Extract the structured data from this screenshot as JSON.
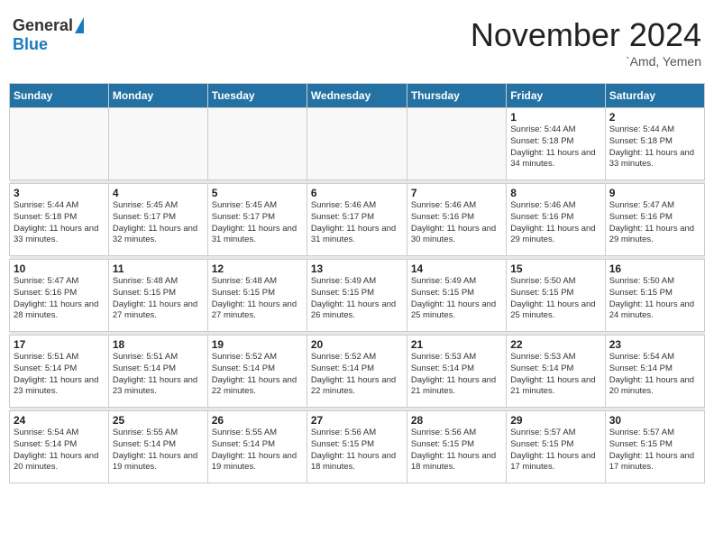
{
  "header": {
    "logo_general": "General",
    "logo_blue": "Blue",
    "month_title": "November 2024",
    "location": "`Amd, Yemen"
  },
  "weekdays": [
    "Sunday",
    "Monday",
    "Tuesday",
    "Wednesday",
    "Thursday",
    "Friday",
    "Saturday"
  ],
  "weeks": [
    [
      {
        "day": "",
        "info": ""
      },
      {
        "day": "",
        "info": ""
      },
      {
        "day": "",
        "info": ""
      },
      {
        "day": "",
        "info": ""
      },
      {
        "day": "",
        "info": ""
      },
      {
        "day": "1",
        "info": "Sunrise: 5:44 AM\nSunset: 5:18 PM\nDaylight: 11 hours\nand 34 minutes."
      },
      {
        "day": "2",
        "info": "Sunrise: 5:44 AM\nSunset: 5:18 PM\nDaylight: 11 hours\nand 33 minutes."
      }
    ],
    [
      {
        "day": "3",
        "info": "Sunrise: 5:44 AM\nSunset: 5:18 PM\nDaylight: 11 hours\nand 33 minutes."
      },
      {
        "day": "4",
        "info": "Sunrise: 5:45 AM\nSunset: 5:17 PM\nDaylight: 11 hours\nand 32 minutes."
      },
      {
        "day": "5",
        "info": "Sunrise: 5:45 AM\nSunset: 5:17 PM\nDaylight: 11 hours\nand 31 minutes."
      },
      {
        "day": "6",
        "info": "Sunrise: 5:46 AM\nSunset: 5:17 PM\nDaylight: 11 hours\nand 31 minutes."
      },
      {
        "day": "7",
        "info": "Sunrise: 5:46 AM\nSunset: 5:16 PM\nDaylight: 11 hours\nand 30 minutes."
      },
      {
        "day": "8",
        "info": "Sunrise: 5:46 AM\nSunset: 5:16 PM\nDaylight: 11 hours\nand 29 minutes."
      },
      {
        "day": "9",
        "info": "Sunrise: 5:47 AM\nSunset: 5:16 PM\nDaylight: 11 hours\nand 29 minutes."
      }
    ],
    [
      {
        "day": "10",
        "info": "Sunrise: 5:47 AM\nSunset: 5:16 PM\nDaylight: 11 hours\nand 28 minutes."
      },
      {
        "day": "11",
        "info": "Sunrise: 5:48 AM\nSunset: 5:15 PM\nDaylight: 11 hours\nand 27 minutes."
      },
      {
        "day": "12",
        "info": "Sunrise: 5:48 AM\nSunset: 5:15 PM\nDaylight: 11 hours\nand 27 minutes."
      },
      {
        "day": "13",
        "info": "Sunrise: 5:49 AM\nSunset: 5:15 PM\nDaylight: 11 hours\nand 26 minutes."
      },
      {
        "day": "14",
        "info": "Sunrise: 5:49 AM\nSunset: 5:15 PM\nDaylight: 11 hours\nand 25 minutes."
      },
      {
        "day": "15",
        "info": "Sunrise: 5:50 AM\nSunset: 5:15 PM\nDaylight: 11 hours\nand 25 minutes."
      },
      {
        "day": "16",
        "info": "Sunrise: 5:50 AM\nSunset: 5:15 PM\nDaylight: 11 hours\nand 24 minutes."
      }
    ],
    [
      {
        "day": "17",
        "info": "Sunrise: 5:51 AM\nSunset: 5:14 PM\nDaylight: 11 hours\nand 23 minutes."
      },
      {
        "day": "18",
        "info": "Sunrise: 5:51 AM\nSunset: 5:14 PM\nDaylight: 11 hours\nand 23 minutes."
      },
      {
        "day": "19",
        "info": "Sunrise: 5:52 AM\nSunset: 5:14 PM\nDaylight: 11 hours\nand 22 minutes."
      },
      {
        "day": "20",
        "info": "Sunrise: 5:52 AM\nSunset: 5:14 PM\nDaylight: 11 hours\nand 22 minutes."
      },
      {
        "day": "21",
        "info": "Sunrise: 5:53 AM\nSunset: 5:14 PM\nDaylight: 11 hours\nand 21 minutes."
      },
      {
        "day": "22",
        "info": "Sunrise: 5:53 AM\nSunset: 5:14 PM\nDaylight: 11 hours\nand 21 minutes."
      },
      {
        "day": "23",
        "info": "Sunrise: 5:54 AM\nSunset: 5:14 PM\nDaylight: 11 hours\nand 20 minutes."
      }
    ],
    [
      {
        "day": "24",
        "info": "Sunrise: 5:54 AM\nSunset: 5:14 PM\nDaylight: 11 hours\nand 20 minutes."
      },
      {
        "day": "25",
        "info": "Sunrise: 5:55 AM\nSunset: 5:14 PM\nDaylight: 11 hours\nand 19 minutes."
      },
      {
        "day": "26",
        "info": "Sunrise: 5:55 AM\nSunset: 5:14 PM\nDaylight: 11 hours\nand 19 minutes."
      },
      {
        "day": "27",
        "info": "Sunrise: 5:56 AM\nSunset: 5:15 PM\nDaylight: 11 hours\nand 18 minutes."
      },
      {
        "day": "28",
        "info": "Sunrise: 5:56 AM\nSunset: 5:15 PM\nDaylight: 11 hours\nand 18 minutes."
      },
      {
        "day": "29",
        "info": "Sunrise: 5:57 AM\nSunset: 5:15 PM\nDaylight: 11 hours\nand 17 minutes."
      },
      {
        "day": "30",
        "info": "Sunrise: 5:57 AM\nSunset: 5:15 PM\nDaylight: 11 hours\nand 17 minutes."
      }
    ]
  ]
}
